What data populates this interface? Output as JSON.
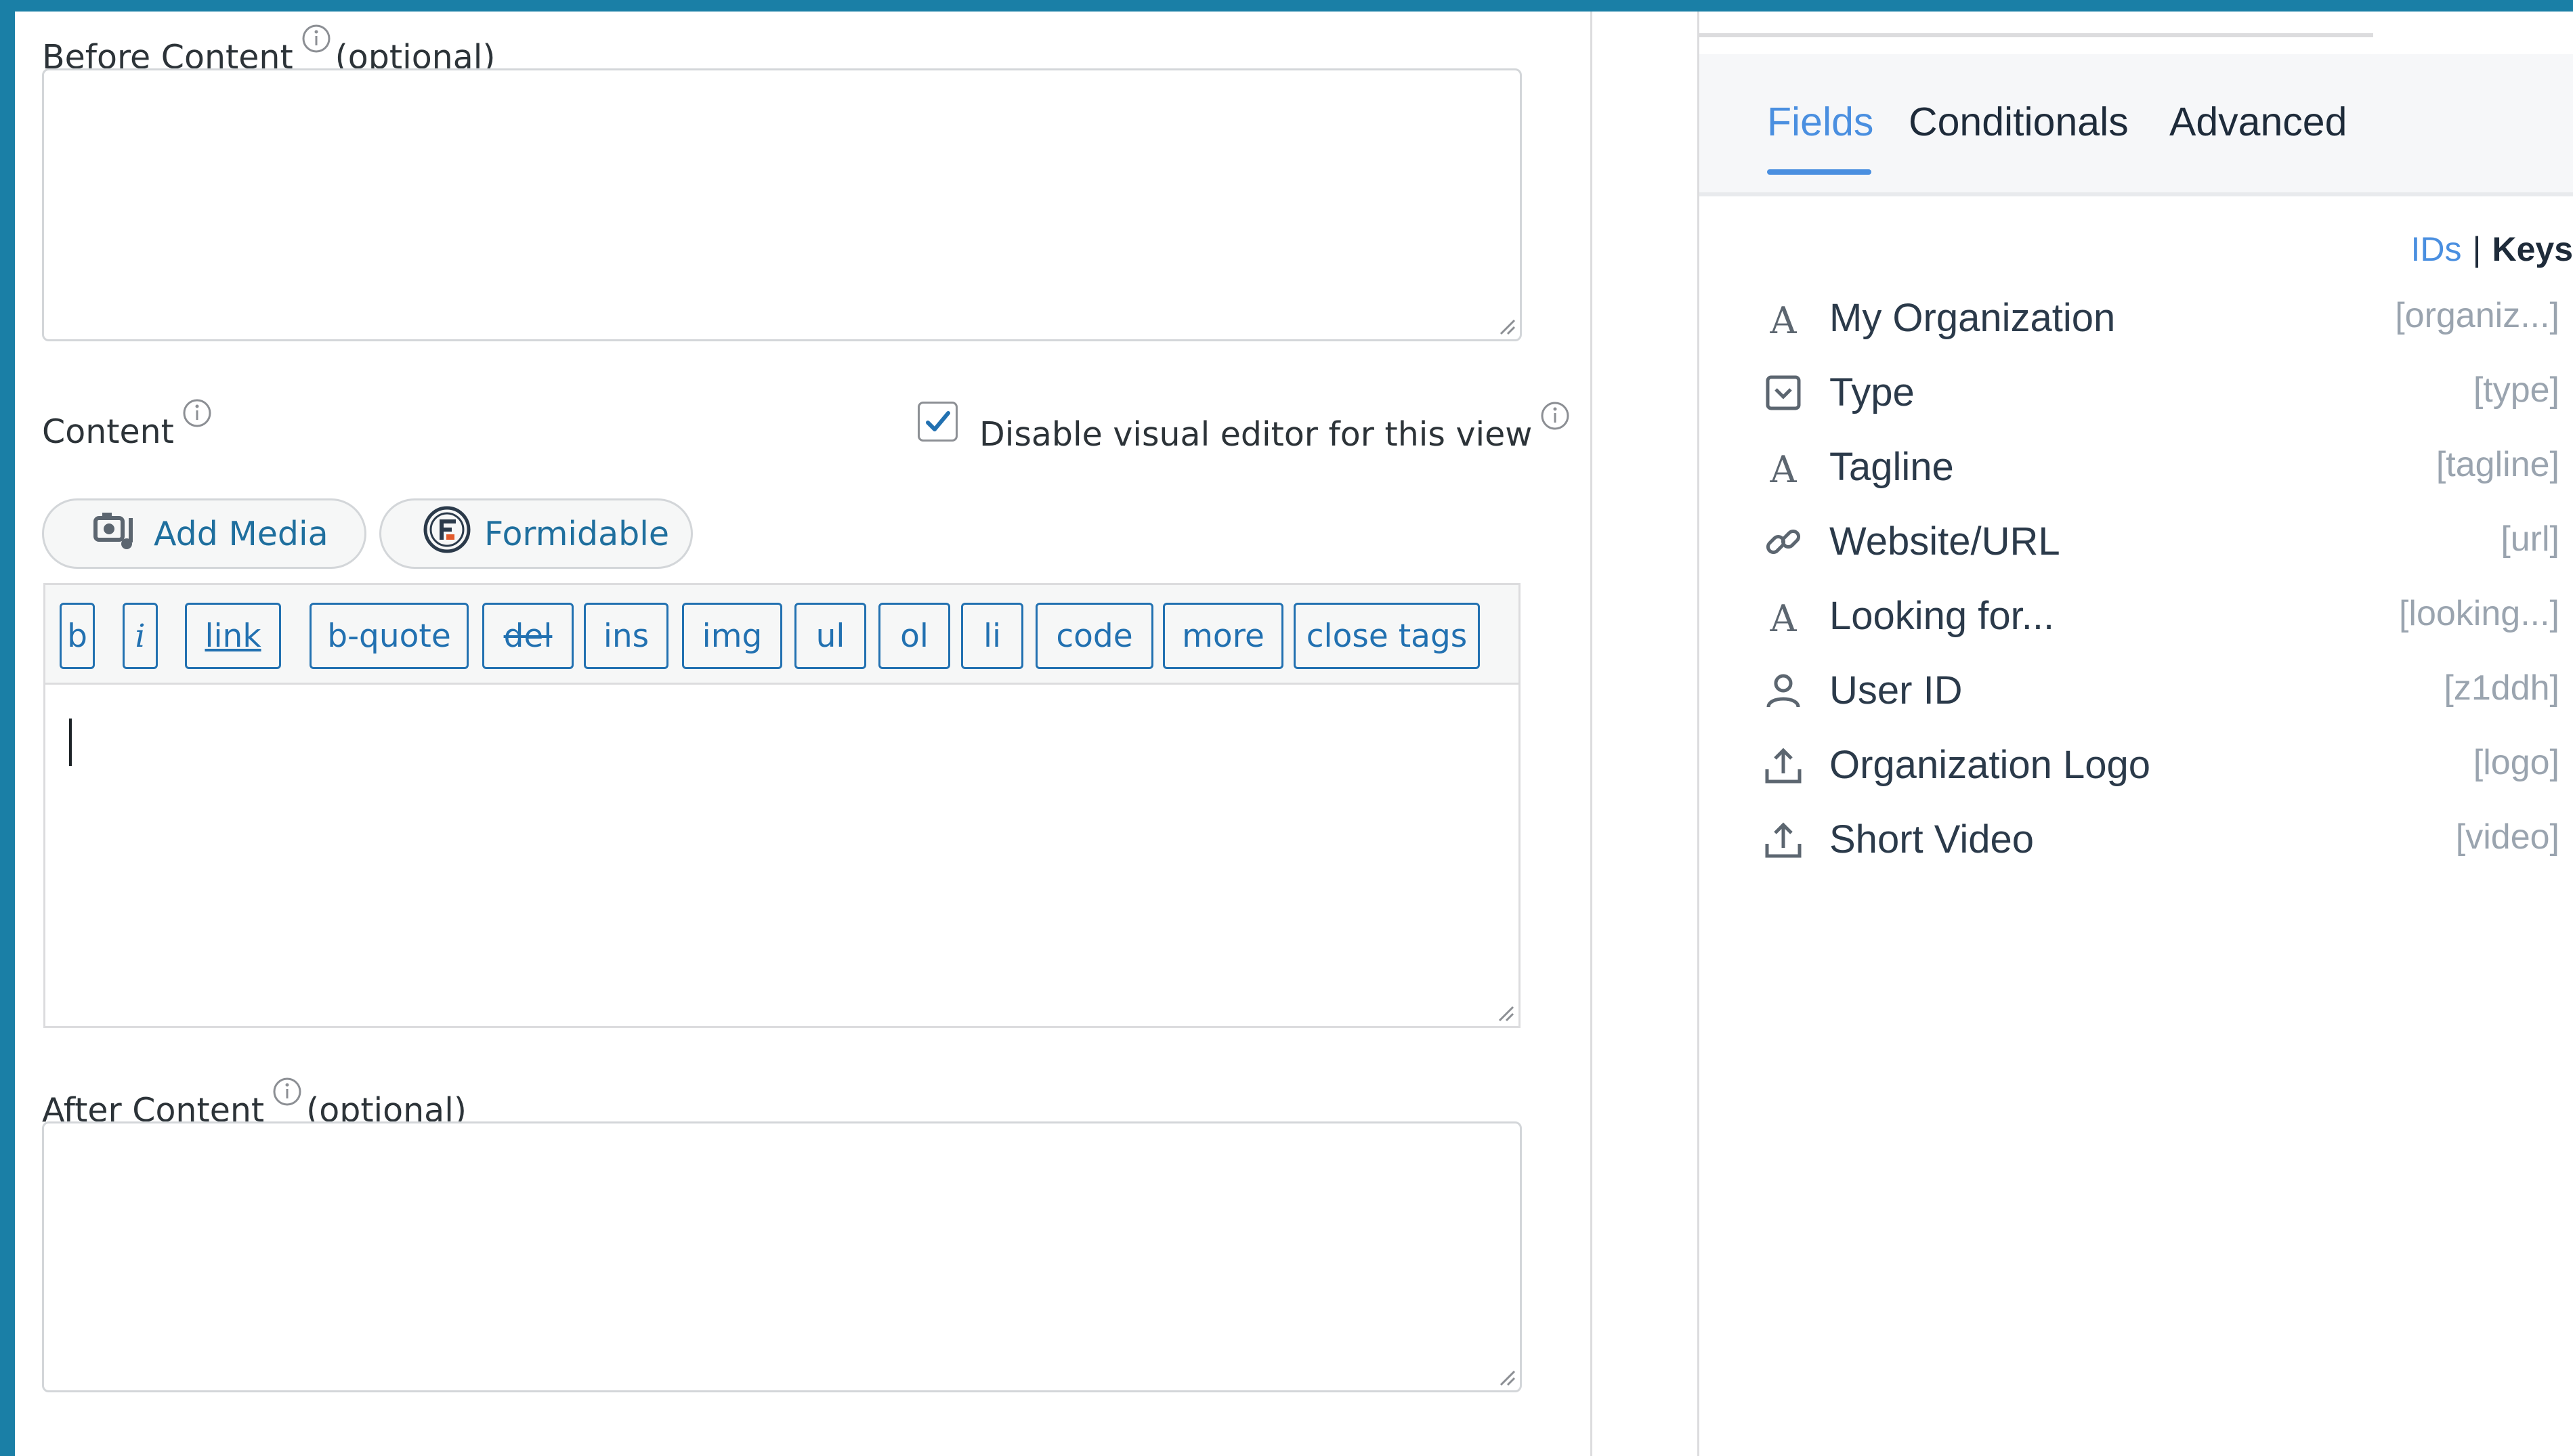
{
  "editor": {
    "before_content_label": "Before Content",
    "before_content_optional": "(optional)",
    "before_content_value": "",
    "content_label": "Content",
    "disable_visual_editor_label": "Disable visual editor for this view",
    "disable_visual_editor_checked": true,
    "add_media_label": "Add Media",
    "formidable_label": "Formidable",
    "quicktags": [
      "b",
      "i",
      "link",
      "b-quote",
      "del",
      "ins",
      "img",
      "ul",
      "ol",
      "li",
      "code",
      "more",
      "close tags"
    ],
    "content_value": "",
    "after_content_label": "After Content",
    "after_content_optional": "(optional)",
    "after_content_value": ""
  },
  "panel": {
    "tabs": [
      "Fields",
      "Conditionals",
      "Advanced"
    ],
    "active_tab": "Fields",
    "ids_label": "IDs",
    "separator": "|",
    "keys_label": "Keys",
    "fields": [
      {
        "name": "My Organization",
        "key": "[organiz...]",
        "icon": "text-icon"
      },
      {
        "name": "Type",
        "key": "[type]",
        "icon": "dropdown-icon"
      },
      {
        "name": "Tagline",
        "key": "[tagline]",
        "icon": "text-icon"
      },
      {
        "name": "Website/URL",
        "key": "[url]",
        "icon": "link-icon"
      },
      {
        "name": "Looking for...",
        "key": "[looking...]",
        "icon": "text-icon"
      },
      {
        "name": "User ID",
        "key": "[z1ddh]",
        "icon": "user-icon"
      },
      {
        "name": "Organization Logo",
        "key": "[logo]",
        "icon": "upload-icon"
      },
      {
        "name": "Short Video",
        "key": "[video]",
        "icon": "upload-icon"
      }
    ]
  },
  "colors": {
    "frame": "#1a7fa6",
    "link_blue": "#2271b1",
    "tab_active": "#4a8fe0",
    "key_gray": "#9aa4af"
  }
}
